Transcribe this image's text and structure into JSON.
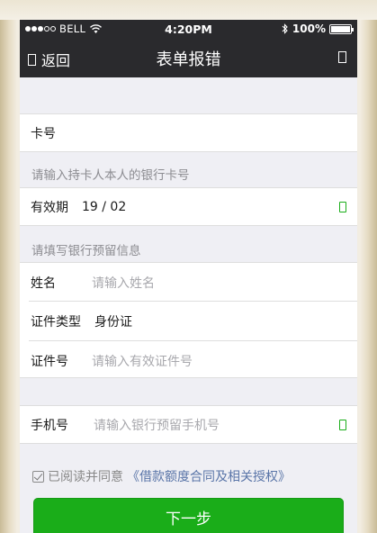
{
  "status_bar": {
    "carrier": "BELL",
    "time": "4:20PM",
    "battery": "100%",
    "icons": [
      "signal-dots",
      "wifi-icon",
      "bluetooth-icon",
      "battery-icon"
    ]
  },
  "nav": {
    "back_label": "返回",
    "title": "表单报错",
    "back_icon": "box-icon",
    "right_icon": "box-icon"
  },
  "form": {
    "card_label": "卡号",
    "card_hint": "请输入持卡人本人的银行卡号",
    "expiry_label": "有效期",
    "expiry_value": "19 / 02",
    "bank_section": "请填写银行预留信息",
    "name_label": "姓名",
    "name_placeholder": "请输入姓名",
    "id_type_label": "证件类型",
    "id_type_value": "身份证",
    "id_number_label": "证件号",
    "id_number_placeholder": "请输入有效证件号",
    "phone_label": "手机号",
    "phone_placeholder": "请输入银行预留手机号"
  },
  "agreement": {
    "text": "已阅读并同意",
    "link": "《借款额度合同及相关授权》",
    "checked": true
  },
  "next_button": "下一步",
  "colors": {
    "accent": "#1aad19",
    "navbar": "#2a2a2d",
    "background": "#efeff4",
    "link": "#5a75a8"
  }
}
